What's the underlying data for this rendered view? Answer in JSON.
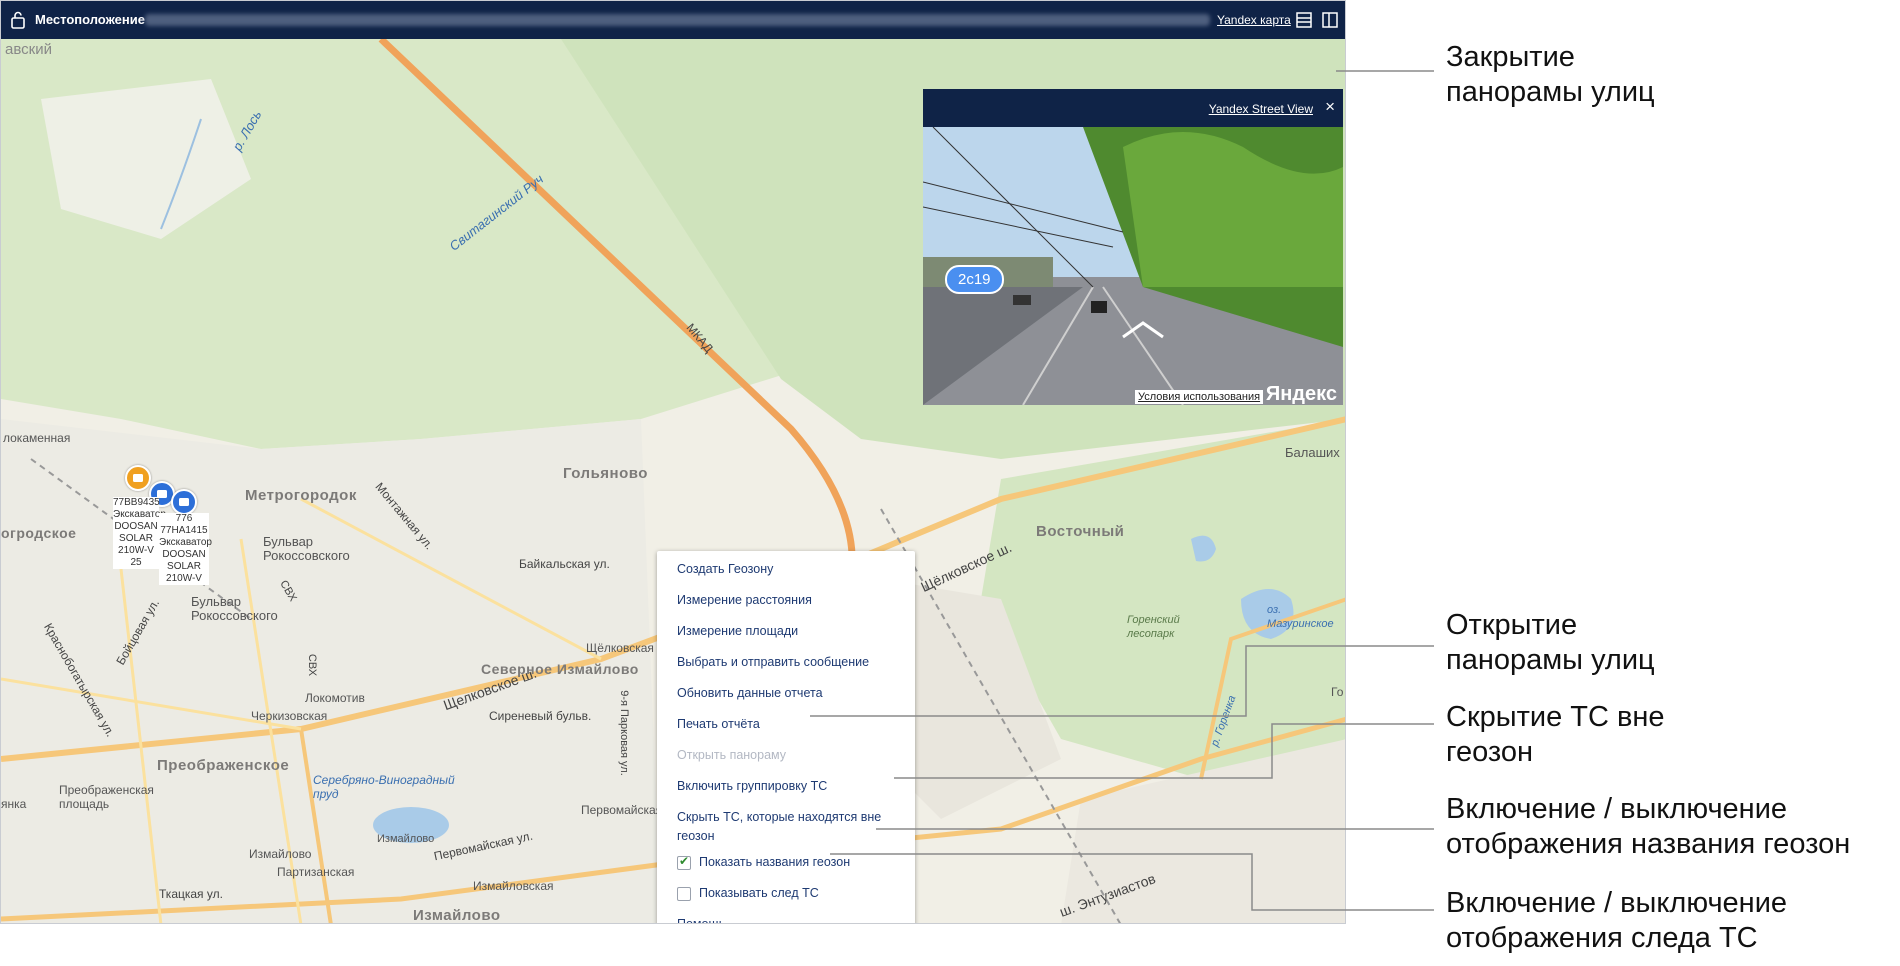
{
  "window": {
    "title": "Местоположение",
    "map_provider_label": "Yandex карта"
  },
  "map_labels": {
    "vskiy": "авский",
    "los_river": "р. Лось",
    "svitaginsky": "Свитагинский Руч",
    "mkad": "МКАД",
    "lokomennaya": "локаменная",
    "metrogorodok": "Метрогородок",
    "golyanovo": "Гольяново",
    "vostochny": "Восточный",
    "balashikha": "Балаших",
    "montazhnaya": "Монтажная ул.",
    "bulvar_rokoss_1": "Бульвар Рокоссовского",
    "bulvar_rokoss_2": "Бульвар Рокоссовского",
    "baykalskaya": "Байкальская ул.",
    "shchelkovskoe_1": "Щелковское ш.",
    "shchelkovskoe_2": "Щёлковское ш.",
    "shchelkovskaya": "Щёлковская",
    "severnoe_izm": "Северное Измайлово",
    "lokomotiv": "Локомотив",
    "cherkizovskaya": "Черкизовская",
    "sirenevy": "Сиреневый бульв.",
    "parkovaya": "9-я Парковая ул.",
    "preobrazhenskoe": "Преображенское",
    "preobr_plosh": "Преображенская площадь",
    "serebryano": "Серебряно-Виноградный пруд",
    "izmaylovo_1": "Измайлово",
    "izmaylovo_2": "Измайлово",
    "izmaylovskaya": "Измайловская",
    "izmaylovo_big": "Измайлово",
    "pervomayskaya_1": "Первомайская ул.",
    "pervomayskaya_2": "Первомайская",
    "partizanskaya": "Партизанская",
    "tkatskaya": "Ткацкая ул.",
    "boytsovaya": "Бойцовая ул.",
    "krasnobog": "Краснобогатырская ул.",
    "grodskoe": "огродское",
    "svh_1": "СВХ",
    "svh_2": "СВХ",
    "gorensky": "Горенский лесопарк",
    "mazurinskoe": "оз. Мазуринское",
    "gorenka": "р. Горенка",
    "entuziastov": "ш. Энтузиастов",
    "yinka": "янка",
    "go": "Го"
  },
  "vehicles": [
    {
      "label": "77ВВ9435 Экскаватор DOOSAN SOLAR 210W-V 25",
      "color": "#f0a020"
    },
    {
      "label": "776 77НА1415 Экскаватор DOOSAN SOLAR 210W-V",
      "color": "#2d6fd8"
    },
    {
      "label": "",
      "color": "#2d6fd8"
    }
  ],
  "street_view": {
    "title": "Yandex Street View",
    "close": "×",
    "badge": "2с19",
    "terms": "Условия использования",
    "logo": "Яндекс"
  },
  "context_menu": {
    "items": [
      {
        "label": "Создать Геозону"
      },
      {
        "label": "Измерение расстояния"
      },
      {
        "label": "Измерение площади"
      },
      {
        "label": "Выбрать и отправить сообщение"
      },
      {
        "label": "Обновить данные отчета"
      },
      {
        "label": "Печать отчёта"
      },
      {
        "label": "Открыть панораму"
      },
      {
        "label": "Включить группировку ТС"
      },
      {
        "label": "Скрыть ТС, которые находятся вне геозон"
      },
      {
        "label": "Показать названия геозон",
        "checked": true
      },
      {
        "label": "Показывать след ТС",
        "checked": false
      },
      {
        "label": "Помощь"
      }
    ]
  },
  "annotations": {
    "close_panorama": "Закрытие\nпанорамы улиц",
    "open_panorama": "Открытие\nпанорамы улиц",
    "hide_vehicles": "Скрытие ТС вне\nгеозон",
    "toggle_geozone_names": "Включение / выключение\nотображения названия геозон",
    "toggle_trail": "Включение / выключение\nотображения следа ТС"
  }
}
